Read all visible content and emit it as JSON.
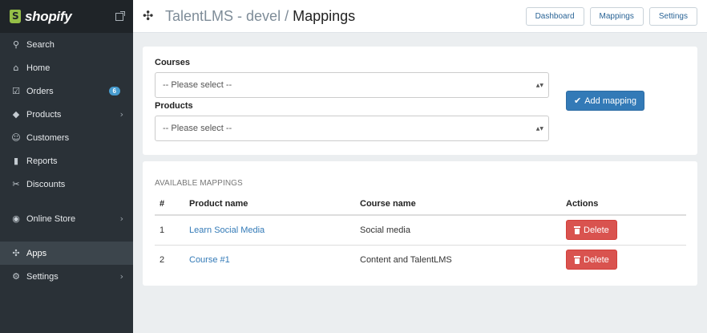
{
  "app": {
    "logo_text": "shopify"
  },
  "sidebar": {
    "items": [
      {
        "label": "Search",
        "icon": "search-icon"
      },
      {
        "label": "Home",
        "icon": "home-icon"
      },
      {
        "label": "Orders",
        "icon": "orders-icon",
        "badge": "6"
      },
      {
        "label": "Products",
        "icon": "tag-icon"
      },
      {
        "label": "Customers",
        "icon": "customers-icon"
      },
      {
        "label": "Reports",
        "icon": "bar-chart-icon"
      },
      {
        "label": "Discounts",
        "icon": "discount-icon"
      },
      {
        "label": "Online Store",
        "icon": "globe-icon"
      },
      {
        "label": "Apps",
        "icon": "puzzle-icon"
      },
      {
        "label": "Settings",
        "icon": "gear-icon"
      }
    ]
  },
  "header": {
    "title_app": "TalentLMS - devel",
    "title_sep": "/",
    "title_page": "Mappings",
    "buttons": [
      "Dashboard",
      "Mappings",
      "Settings"
    ]
  },
  "form": {
    "courses_label": "Courses",
    "courses_value": "-- Please select --",
    "products_label": "Products",
    "products_value": "-- Please select --",
    "add_button": "Add mapping"
  },
  "mappings": {
    "heading": "AVAILABLE MAPPINGS",
    "columns": [
      "#",
      "Product name",
      "Course name",
      "Actions"
    ],
    "rows": [
      {
        "num": "1",
        "product": "Learn Social Media",
        "course": "Social media",
        "action": "Delete"
      },
      {
        "num": "2",
        "product": "Course #1",
        "course": "Content and TalentLMS",
        "action": "Delete"
      }
    ]
  },
  "colors": {
    "sidebar_bg": "#2a3137",
    "primary": "#337ab7",
    "danger": "#d9534f",
    "badge": "#479ccf",
    "logo_green": "#95bf47"
  }
}
